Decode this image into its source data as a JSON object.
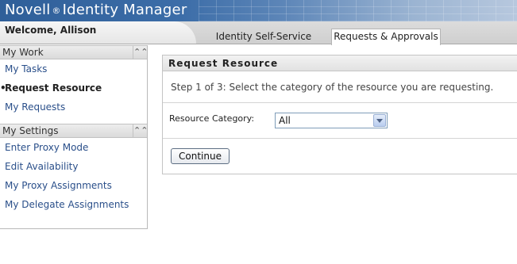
{
  "header": {
    "brand_name": "Novell",
    "brand_reg": "®",
    "brand_product": "Identity Manager",
    "welcome": "Welcome, Allison",
    "tabs": [
      {
        "label": "Identity Self-Service",
        "selected": false
      },
      {
        "label": "Requests & Approvals",
        "selected": true
      }
    ]
  },
  "sidebar": {
    "my_work": {
      "title": "My Work",
      "items": [
        {
          "label": "My Tasks"
        },
        {
          "label": "Request Resource",
          "active": true
        },
        {
          "label": "My Requests"
        }
      ]
    },
    "my_settings": {
      "title": "My Settings",
      "items": [
        {
          "label": "Enter Proxy Mode"
        },
        {
          "label": "Edit Availability"
        },
        {
          "label": "My Proxy Assignments"
        },
        {
          "label": "My Delegate Assignments"
        }
      ]
    }
  },
  "main": {
    "title": "Request Resource",
    "step_text": "Step 1 of 3: Select the category of the resource you are requesting.",
    "category_label": "Resource Category:",
    "category_value": "All",
    "continue_label": "Continue"
  },
  "colors": {
    "banner": "#3c6da8",
    "link": "#2a4f8a"
  }
}
